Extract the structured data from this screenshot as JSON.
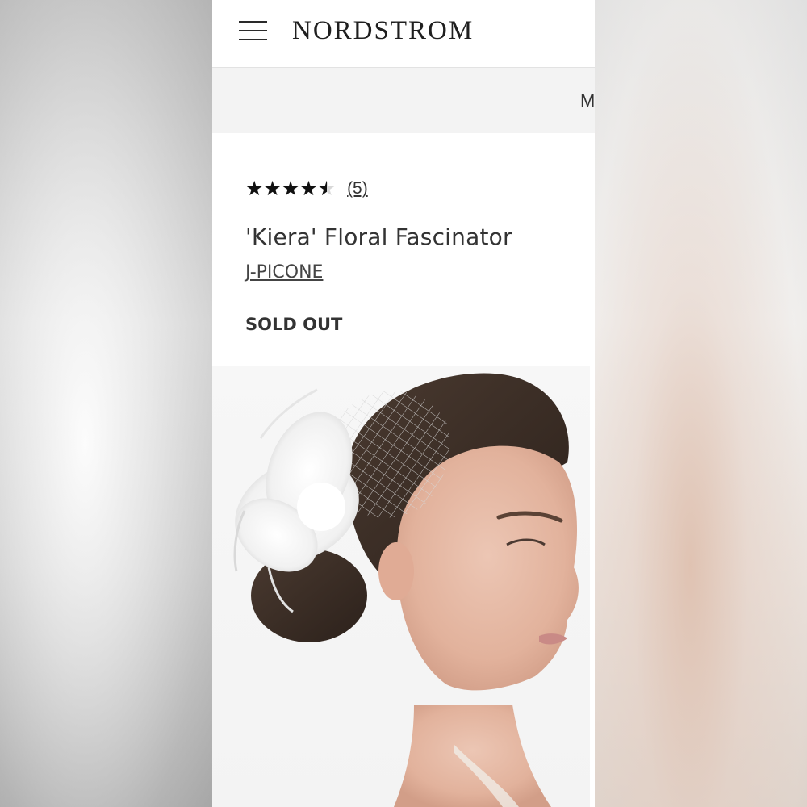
{
  "header": {
    "brand": "NORDSTROM",
    "menu_icon": "hamburger-menu-icon"
  },
  "promo": {
    "text": "M"
  },
  "product": {
    "rating": 4.5,
    "rating_max": 5,
    "review_count": "(5)",
    "title": "'Kiera' Floral Fascinator",
    "brand": "J-PICONE",
    "status": "SOLD OUT"
  },
  "image": {
    "alt": "Model wearing white feather and birdcage veil fascinator"
  }
}
